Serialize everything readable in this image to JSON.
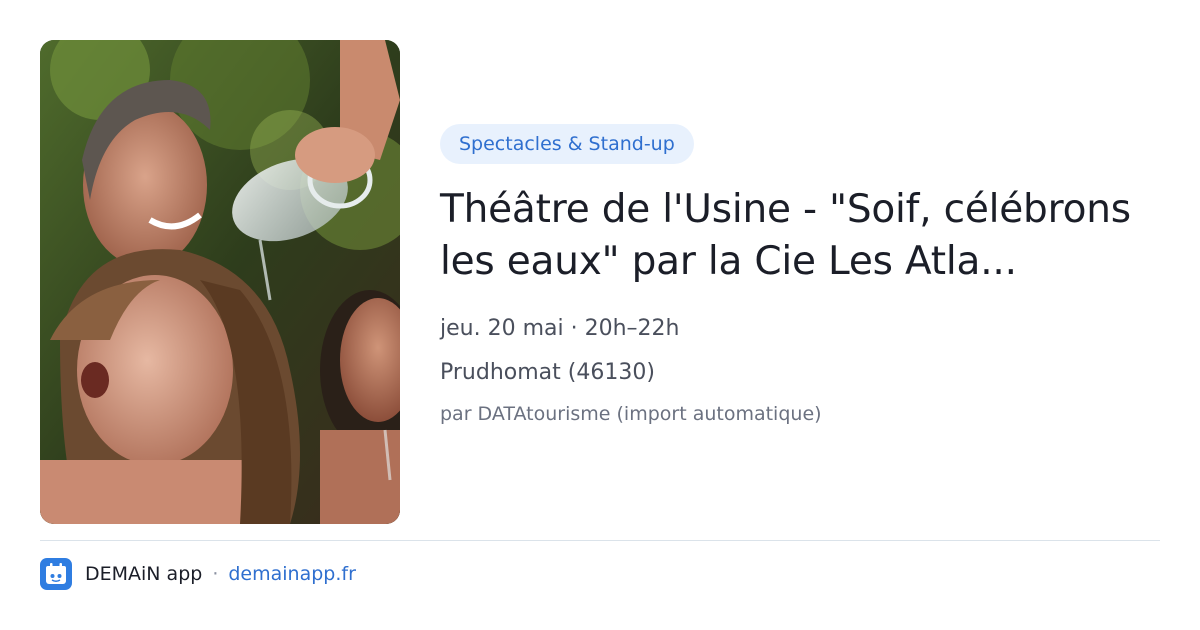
{
  "event": {
    "category": "Spectacles & Stand-up",
    "title": "Théâtre de l'Usine - \"Soif, célébrons les eaux\" par la Cie Les Atla...",
    "date": "jeu. 20 mai · 20h–22h",
    "location": "Prudhomat (46130)",
    "source": "par DATAtourisme (import automatique)"
  },
  "footer": {
    "app_name": "DEMAiN app",
    "separator": "·",
    "url": "demainapp.fr",
    "logo_icon": "demain-app-logo-icon"
  },
  "colors": {
    "accent": "#2f6fcf",
    "badge_bg": "#e8f1fd",
    "title": "#1b1e28",
    "meta": "#4a4f5c",
    "source": "#6b7180",
    "logo_bg": "#2f7de1"
  }
}
